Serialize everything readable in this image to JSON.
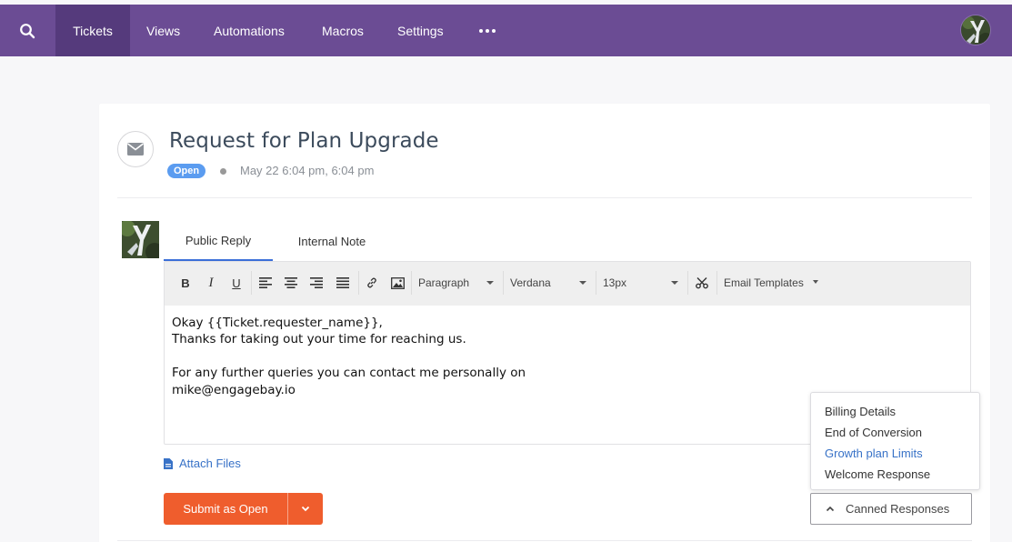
{
  "nav": {
    "items": [
      "Tickets",
      "Views",
      "Automations",
      "Macros",
      "Settings"
    ],
    "active": "Tickets",
    "icons": {
      "search": "search-icon",
      "more": "more-icon",
      "avatar": "user-avatar"
    }
  },
  "ticket": {
    "title": "Request for Plan Upgrade",
    "status": "Open",
    "date": "May 22 6:04 pm, 6:04 pm"
  },
  "reply": {
    "tabs": [
      "Public Reply",
      "Internal Note"
    ],
    "active_tab": "Public Reply",
    "toolbar": {
      "format": "Paragraph",
      "font": "Verdana",
      "size": "13px",
      "templates": "Email Templates"
    },
    "body": "Okay {{Ticket.requester_name}},\nThanks for taking out your time for reaching us.\n\nFor any further queries you can contact me personally on\nmike@engagebay.io",
    "attach_label": "Attach Files",
    "submit_label": "Submit as Open"
  },
  "canned": {
    "button_label": "Canned Responses",
    "items": [
      "Billing Details",
      "End of Conversion",
      "Growth plan Limits",
      "Welcome Response"
    ],
    "highlighted": "Growth plan Limits"
  },
  "colors": {
    "nav_bg": "#6b4c94",
    "nav_active": "#553a7c",
    "badge": "#5b9cf0",
    "submit": "#ef5d2d",
    "link": "#3872c7",
    "tab_active": "#3b6fd8"
  }
}
